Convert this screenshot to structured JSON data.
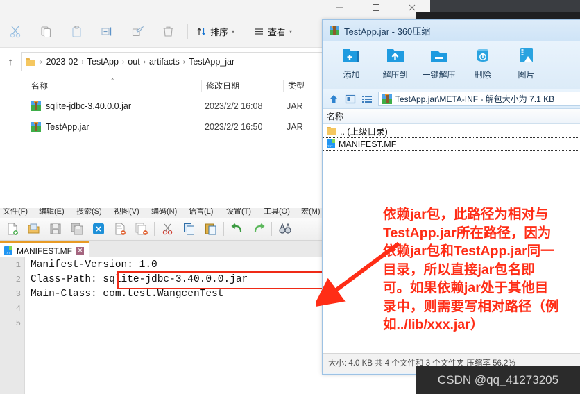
{
  "explorer": {
    "window_controls": [
      "minimize",
      "maximize",
      "close"
    ],
    "toolbar": {
      "icons": [
        "cut-icon",
        "copy-icon",
        "paste-icon",
        "rename-icon",
        "share-icon",
        "delete-icon"
      ],
      "sort_label": "排序",
      "view_label": "查看"
    },
    "address": {
      "up_label": "↑",
      "chevron": "«",
      "crumbs": [
        "2023-02",
        "TestApp",
        "out",
        "artifacts",
        "TestApp_jar"
      ]
    },
    "columns": [
      "名称",
      "修改日期",
      "类型"
    ],
    "files": [
      {
        "name": "sqlite-jdbc-3.40.0.0.jar",
        "date": "2023/2/2 16:08",
        "type": "JAR"
      },
      {
        "name": "TestApp.jar",
        "date": "2023/2/2 16:50",
        "type": "JAR"
      }
    ]
  },
  "editor": {
    "menus": [
      "文件(F)",
      "编辑(E)",
      "搜索(S)",
      "视图(V)",
      "编码(N)",
      "语言(L)",
      "设置(T)",
      "工具(O)",
      "宏(M)"
    ],
    "toolbar_icons": [
      "new-file-icon",
      "open-file-icon",
      "save-icon",
      "save-all-icon",
      "close-icon",
      "close-file-icon",
      "close-all-icon",
      "cut-icon",
      "copy-icon",
      "paste-icon",
      "undo-icon",
      "redo-icon",
      "find-icon"
    ],
    "tab": {
      "label": "MANIFEST.MF",
      "close": "✕"
    },
    "line_numbers": [
      "1",
      "2",
      "3",
      "4",
      "5"
    ],
    "lines": [
      "Manifest-Version: 1.0",
      "Class-Path: sqlite-jdbc-3.40.0.0.jar",
      "Main-Class: com.test.WangcenTest",
      "",
      ""
    ],
    "highlight_color": "#ef2a16"
  },
  "zip_window": {
    "title": "TestApp.jar - 360压缩",
    "title_icon": "jar-file-icon",
    "toolbar_buttons": [
      {
        "label": "添加",
        "icon": "add-folder-icon"
      },
      {
        "label": "解压到",
        "icon": "extract-to-icon"
      },
      {
        "label": "一键解压",
        "icon": "one-click-extract-icon"
      },
      {
        "label": "删除",
        "icon": "recycle-bin-icon"
      },
      {
        "label": "图片",
        "icon": "picture-icon"
      }
    ],
    "nav_icons": [
      "up-arrow-icon",
      "view-detail-icon",
      "view-list-icon"
    ],
    "path_text": "TestApp.jar\\META-INF - 解包大小为 7.1 KB",
    "column_header": "名称",
    "entries": [
      {
        "name": ".. (上级目录)",
        "icon": "folder-icon",
        "selected": false
      },
      {
        "name": "MANIFEST.MF",
        "icon": "text-file-icon",
        "selected": true
      }
    ],
    "status": "大小: 4.0 KB 共 4 个文件和 3 个文件夹 压缩率 56.2%"
  },
  "annotation": {
    "color": "#ff2d16",
    "lines": [
      "依赖jar包，此路径为相对与",
      "TestApp.jar所在路径，因为",
      "依赖jar包和TestApp.jar同一",
      "目录，所以直接jar包名即",
      "可。如果依赖jar处于其他目",
      "录中，则需要写相对路径（例",
      "如../lib/xxx.jar）"
    ]
  },
  "watermark": {
    "text": "CSDN @qq_41273205"
  }
}
